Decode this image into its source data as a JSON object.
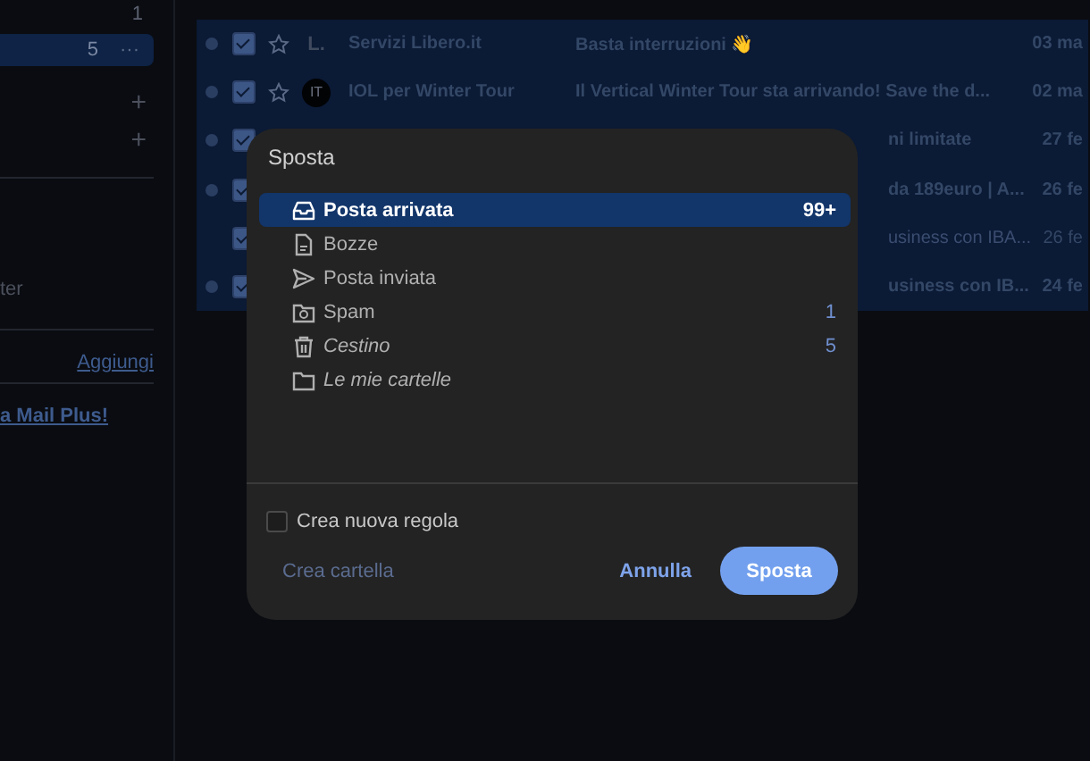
{
  "sidebar": {
    "top_count": "1",
    "selected_folder": {
      "count": "5",
      "more": "···",
      "selected": true
    },
    "add_buttons": [
      "+",
      "+"
    ],
    "folder_tail": "ter",
    "add_link": "Aggiungi",
    "promo_link": "a Mail Plus!"
  },
  "emails": [
    {
      "unread": true,
      "checked": true,
      "starred": false,
      "avatar": {
        "text": "L.",
        "kind": "letter"
      },
      "sender": "Servizi Libero.it",
      "subject": "Basta interruzioni 👋",
      "date": "03 ma"
    },
    {
      "unread": true,
      "checked": true,
      "starred": false,
      "avatar": {
        "text": "IT",
        "kind": "circle"
      },
      "sender": "IOL per Winter Tour",
      "subject": "Il Vertical Winter Tour sta arrivando! Save the d...",
      "date": "02 ma"
    },
    {
      "unread": true,
      "checked": true,
      "subject": "ni limitate",
      "date": "27 fe"
    },
    {
      "unread": true,
      "checked": true,
      "subject": "da 189euro | A...",
      "date": "26 fe"
    },
    {
      "unread": false,
      "checked": true,
      "subject": "usiness con IBA...",
      "date": "26 fe"
    },
    {
      "unread": true,
      "checked": true,
      "subject": "usiness con IB...",
      "date": "24 fe"
    }
  ],
  "dialog": {
    "title": "Sposta",
    "folders": [
      {
        "kind": "inbox",
        "label": "Posta arrivata",
        "count": "99+",
        "selected": true,
        "italic": false
      },
      {
        "kind": "draft",
        "label": "Bozze",
        "selected": false,
        "italic": false
      },
      {
        "kind": "sent",
        "label": "Posta inviata",
        "selected": false,
        "italic": false
      },
      {
        "kind": "spam",
        "label": "Spam",
        "count": "1",
        "selected": false,
        "italic": false
      },
      {
        "kind": "trash",
        "label": "Cestino",
        "count": "5",
        "selected": false,
        "italic": true
      },
      {
        "kind": "folder",
        "label": "Le mie cartelle",
        "selected": false,
        "italic": true
      }
    ],
    "rule_checkbox": {
      "label": "Crea nuova regola",
      "checked": false
    },
    "buttons": [
      {
        "kind": "link",
        "label": "Crea cartella",
        "disabled": true
      },
      {
        "kind": "text",
        "label": "Annulla",
        "disabled": false
      },
      {
        "kind": "primary",
        "label": "Sposta",
        "disabled": false
      }
    ]
  }
}
